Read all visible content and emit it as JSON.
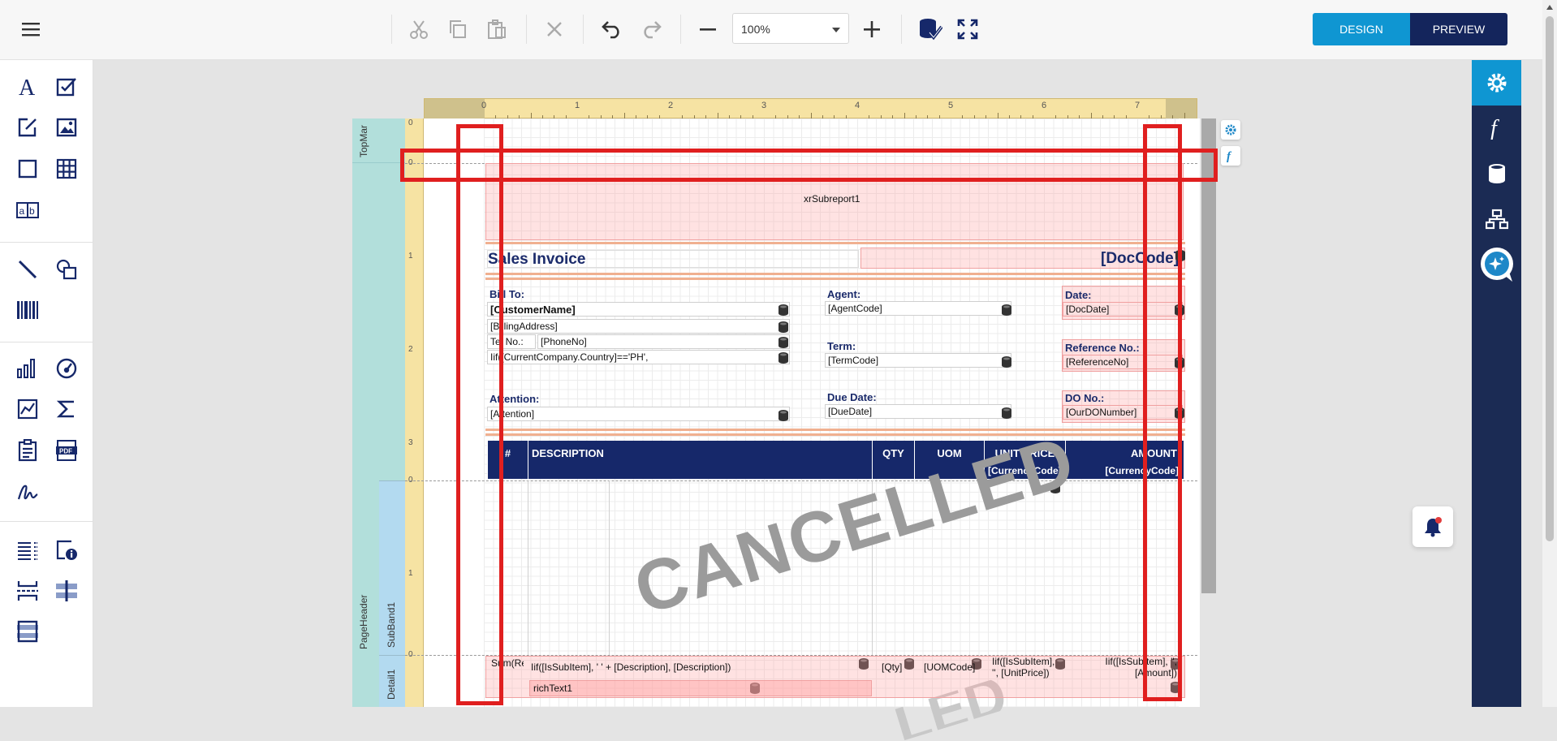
{
  "toolbar": {
    "zoom_value": "100%",
    "design_label": "DESIGN",
    "preview_label": "PREVIEW"
  },
  "bands": {
    "top_margin": "TopMar",
    "page_header": "PageHeader",
    "subband1": "SubBand1",
    "detail1": "Detail1"
  },
  "ruler": {
    "top_ticks": [
      "0",
      "1",
      "2",
      "3",
      "4",
      "5",
      "6",
      "7"
    ],
    "left_ticks_header": [
      "0",
      "1",
      "2",
      "3"
    ],
    "left_ticks_sub": [
      "0",
      "1"
    ],
    "left_ticks_detail": [
      "0"
    ],
    "left_ticks_topmargin": [
      "0"
    ]
  },
  "report": {
    "subreport": "xrSubreport1",
    "title": "Sales Invoice",
    "doccode": "[DocCode]",
    "bill_to_label": "Bill To:",
    "customer_name": "[CustomerName]",
    "billing_address": "[BillingAddress]",
    "tel_label": "Tel No.:",
    "phone": "[PhoneNo]",
    "iif_country": "Iif([CurrentCompany.Country]=='PH',",
    "attention_label": "Attention:",
    "attention": "[Attention]",
    "agent_label": "Agent:",
    "agent": "[AgentCode]",
    "term_label": "Term:",
    "term": "[TermCode]",
    "due_label": "Due Date:",
    "due": "[DueDate]",
    "date_label": "Date:",
    "date": "[DocDate]",
    "ref_label": "Reference No.:",
    "ref": "[ReferenceNo]",
    "do_label": "DO No.:",
    "do": "[OurDONumber]",
    "cancelled": "CANCELLED",
    "header_cols": [
      "#",
      "DESCRIPTION",
      "QTY",
      "UOM",
      "UNIT PRICE",
      "AMOUNT"
    ],
    "currency1": "[CurrencyCode]",
    "currency2": "[CurrencyCode]",
    "detail_seq": "Sum(RecordNu",
    "detail_desc": "Iif([IsSubItem], '   ' + [Description], [Description])",
    "detail_qty": "[Qty]",
    "detail_uom": "[UOMCode]",
    "detail_price": "Iif([IsSubItem], '', [UnitPrice])",
    "detail_amount": "Iif([IsSubItem], '', [Amount])",
    "richtext": "richText1"
  }
}
